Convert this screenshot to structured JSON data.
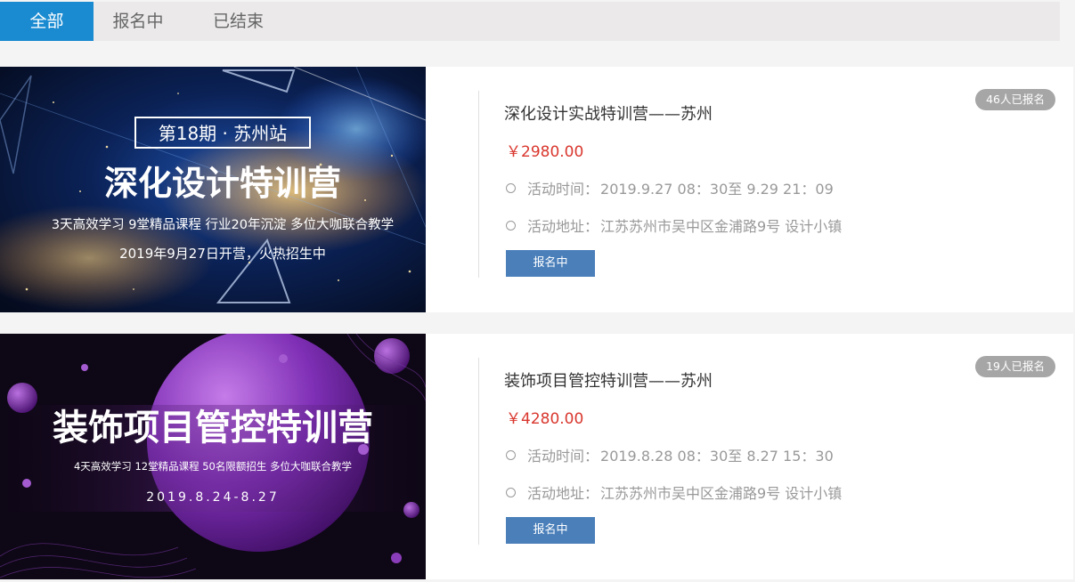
{
  "tabs": [
    {
      "label": "全部",
      "active": true
    },
    {
      "label": "报名中",
      "active": false
    },
    {
      "label": "已结束",
      "active": false
    }
  ],
  "events": [
    {
      "banner": {
        "badge": "第18期 · 苏州站",
        "headline": "深化设计特训营",
        "subline": "3天高效学习 9堂精品课程 行业20年沉淀 多位大咖联合教学",
        "date": "2019年9月27日开营，火热招生中"
      },
      "title": "深化设计实战特训营——苏州",
      "price": "￥2980.00",
      "time_label": "活动时间：",
      "time_value": "2019.9.27 08：30至 9.29 21：09",
      "addr_label": "活动地址：",
      "addr_value": "江苏苏州市吴中区金浦路9号 设计小镇",
      "button": "报名中",
      "count": "46人已报名"
    },
    {
      "banner": {
        "headline": "装饰项目管控特训营",
        "subline": "4天高效学习 12堂精品课程 50名限额招生 多位大咖联合教学",
        "date": "2019.8.24-8.27"
      },
      "title": "装饰项目管控特训营——苏州",
      "price": "￥4280.00",
      "time_label": "活动时间：",
      "time_value": "2019.8.28 08：30至 8.27 15：30",
      "addr_label": "活动地址：",
      "addr_value": "江苏苏州市吴中区金浦路9号 设计小镇",
      "button": "报名中",
      "count": "19人已报名"
    }
  ],
  "colors": {
    "tab_active": "#1b8bd1",
    "price": "#d9372e",
    "button": "#4a7fba",
    "badge": "#a6a6a6"
  }
}
